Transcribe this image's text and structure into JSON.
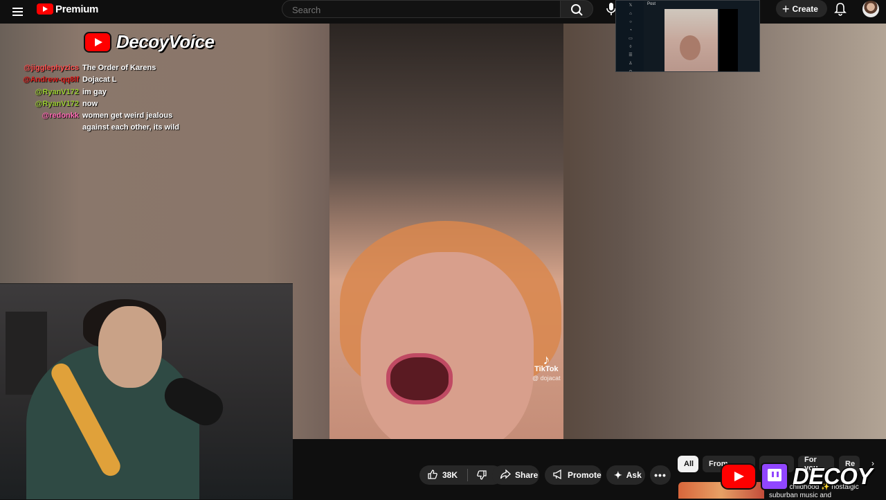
{
  "header": {
    "logo_text": "Premium",
    "search_placeholder": "Search",
    "create_label": "Create"
  },
  "overlay": {
    "brand_name": "DecoyVoice",
    "tiktok_label": "TikTok",
    "tiktok_handle": "@ dojacat",
    "bottom_brand": "DECOY"
  },
  "chat": [
    {
      "user": "@jigglephyzics",
      "text": "The Order of Karens",
      "color": "#ff4f4f"
    },
    {
      "user": "@Andrew-qq8lf",
      "text": "Dojacat L",
      "color": "#e0201f"
    },
    {
      "user": "@RyanV172",
      "text": "im gay",
      "color": "#9acd32"
    },
    {
      "user": "@RyanV172",
      "text": "now",
      "color": "#9acd32"
    },
    {
      "user": "@redonkk",
      "text": "women get weird jealous against each other, its wild",
      "color": "#ff69b4"
    }
  ],
  "pip": {
    "title": "Post",
    "rail_icons": [
      "x-icon",
      "home-icon",
      "search-icon",
      "bell-icon",
      "mail-icon",
      "grok-icon",
      "lists-icon",
      "user-icon",
      "more-icon"
    ]
  },
  "actions": {
    "like_count": "38K",
    "share_label": "Share",
    "promote_label": "Promote",
    "ask_label": "Ask",
    "more_label": "•••"
  },
  "chips": [
    {
      "label": "All",
      "active": true
    },
    {
      "label": "From",
      "active": false
    },
    {
      "label": "",
      "active": false
    },
    {
      "label": "For you",
      "active": false
    },
    {
      "label": "Re",
      "active": false
    }
  ],
  "recommendation": {
    "title": "movie childhood ✨ nostalgic suburban music and"
  },
  "colors": {
    "youtube_red": "#ff0000",
    "twitch_purple": "#9146ff",
    "background": "#0f0f0f"
  }
}
